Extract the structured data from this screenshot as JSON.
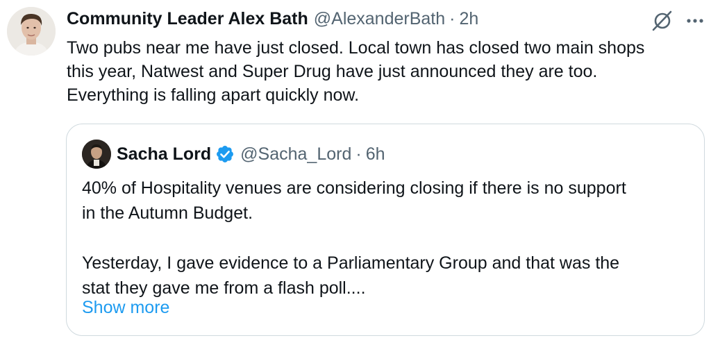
{
  "tweet": {
    "author_name": "Community Leader Alex Bath",
    "author_handle": "@AlexanderBath",
    "separator": "·",
    "time": "2h",
    "text": "Two pubs near me have just closed. Local town has closed two main shops\nthis year, Natwest and Super Drug have just announced they are too.\nEverything is falling apart quickly now."
  },
  "quote": {
    "author_name": "Sacha Lord",
    "author_handle": "@Sacha_Lord",
    "separator": "·",
    "time": "6h",
    "text": "40% of Hospitality venues are considering closing if there is no support\nin the Autumn Budget.\n\nYesterday, I gave evidence to a Parliamentary Group and that was the\nstat they gave me from a flash poll....",
    "show_more": "Show more"
  },
  "icons": {
    "grok": "grok-icon",
    "more": "more-options-icon",
    "verified": "verified-badge-icon"
  },
  "colors": {
    "text": "#0f1419",
    "secondary": "#536471",
    "link": "#1d9bf0",
    "verified": "#1d9bf0",
    "border": "#cfd9de"
  }
}
